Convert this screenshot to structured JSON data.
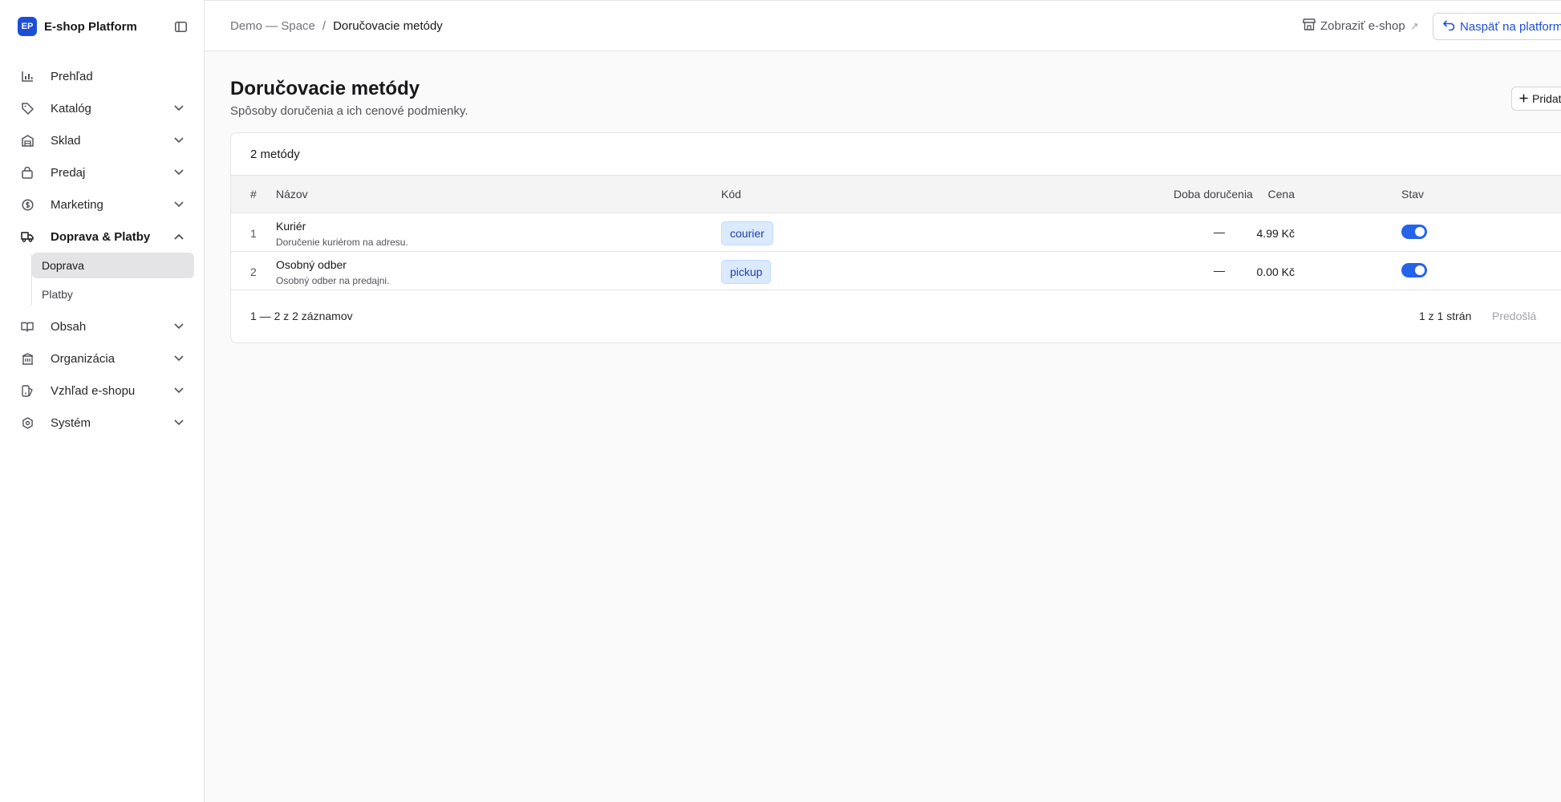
{
  "brand": {
    "logo_text": "EP",
    "name": "E-shop Platform"
  },
  "sidebar": {
    "items": [
      {
        "label": "Prehľad",
        "icon": "chart-icon"
      },
      {
        "label": "Katalóg",
        "icon": "tag-icon"
      },
      {
        "label": "Sklad",
        "icon": "warehouse-icon"
      },
      {
        "label": "Predaj",
        "icon": "bag-icon"
      },
      {
        "label": "Marketing",
        "icon": "coin-icon"
      },
      {
        "label": "Doprava & Platby",
        "icon": "truck-icon"
      },
      {
        "label": "Obsah",
        "icon": "book-icon"
      },
      {
        "label": "Organizácia",
        "icon": "building-icon"
      },
      {
        "label": "Vzhľad e-shopu",
        "icon": "palette-icon"
      },
      {
        "label": "Systém",
        "icon": "settings-icon"
      }
    ],
    "subitems": [
      {
        "label": "Doprava"
      },
      {
        "label": "Platby"
      }
    ]
  },
  "topbar": {
    "breadcrumb": {
      "parent": "Demo — Space",
      "separator": "/",
      "current": "Doručovacie metódy"
    },
    "view_shop": "Zobraziť e-shop",
    "view_shop_ext": "↗",
    "back": "Naspäť na platformu"
  },
  "page": {
    "title": "Doručovacie metódy",
    "subtitle": "Spôsoby doručenia a ich cenové podmienky.",
    "add_button": "Pridať"
  },
  "table": {
    "count_label": "2 metódy",
    "columns": {
      "num": "#",
      "name": "Názov",
      "code": "Kód",
      "price": "Cena",
      "delivery_time": "Doba doručenia",
      "state": "Stav"
    },
    "rows": [
      {
        "num": "1",
        "name": "Kuriér",
        "description": "Doručenie kuriérom na adresu.",
        "code": "courier",
        "price": "4.99 Kč",
        "delivery_time": "—",
        "enabled": true
      },
      {
        "num": "2",
        "name": "Osobný odber",
        "description": "Osobný odber na predajni.",
        "code": "pickup",
        "price": "0.00 Kč",
        "delivery_time": "—",
        "enabled": true
      }
    ],
    "footer": {
      "range": "1 — 2 z 2 záznamov",
      "pages": "1 z 1 strán",
      "prev": "Predošlá"
    }
  },
  "colors": {
    "accent": "#1d4ed8",
    "toggle_on": "#2563eb",
    "badge_bg": "#dbeafe",
    "active_bg": "#e4e4e7"
  }
}
